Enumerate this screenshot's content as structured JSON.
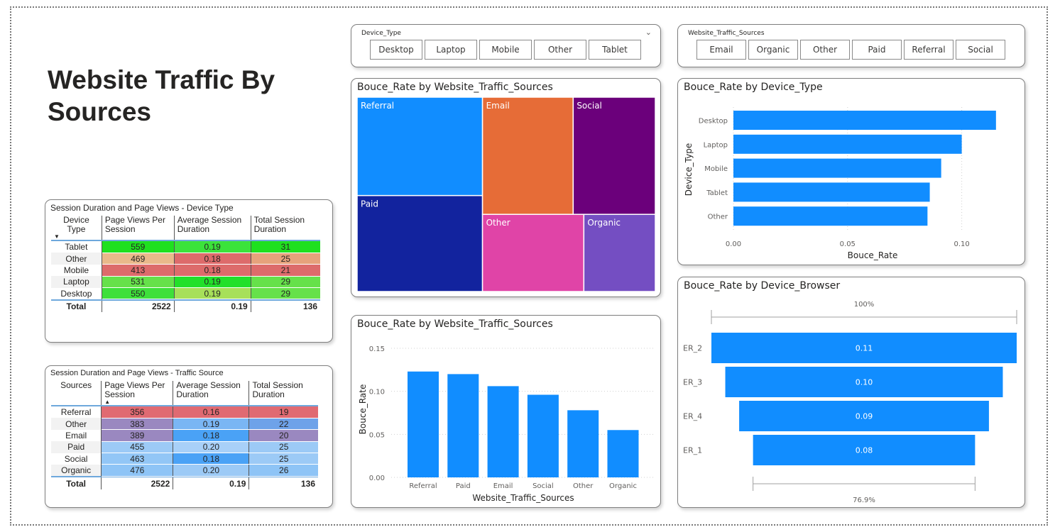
{
  "page": {
    "title": "Website Traffic By Sources"
  },
  "slicer_device": {
    "label": "Device_Type",
    "chevron_icon": "chevron-down-icon",
    "options": [
      "Desktop",
      "Laptop",
      "Mobile",
      "Other",
      "Tablet"
    ]
  },
  "slicer_source": {
    "label": "Website_Traffic_Sources",
    "options": [
      "Email",
      "Organic",
      "Other",
      "Paid",
      "Referral",
      "Social"
    ]
  },
  "table_device": {
    "title": "Session Duration and Page Views - Device Type",
    "headers": [
      "Device Type",
      "Page Views Per Session",
      "Average Session Duration",
      "Total Session Duration"
    ],
    "sort_icon": "sort-down-arrow-icon",
    "rows": [
      {
        "label": "Tablet",
        "values": [
          "559",
          "0.19",
          "31"
        ],
        "colors": [
          "#1fe01f",
          "#3be33b",
          "#1fe01f"
        ]
      },
      {
        "label": "Other",
        "values": [
          "469",
          "0.18",
          "25"
        ],
        "colors": [
          "#e9b98b",
          "#dd6b6b",
          "#e6a27c"
        ]
      },
      {
        "label": "Mobile",
        "values": [
          "413",
          "0.18",
          "21"
        ],
        "colors": [
          "#dd6b6b",
          "#dd6b6b",
          "#dd6b6b"
        ]
      },
      {
        "label": "Laptop",
        "values": [
          "531",
          "0.19",
          "29"
        ],
        "colors": [
          "#66e14a",
          "#22e02a",
          "#66e14a"
        ]
      },
      {
        "label": "Desktop",
        "values": [
          "550",
          "0.19",
          "29"
        ],
        "colors": [
          "#3ee03a",
          "#a7e05a",
          "#66e14a"
        ]
      }
    ],
    "total": {
      "label": "Total",
      "values": [
        "2522",
        "0.19",
        "136"
      ]
    }
  },
  "table_source": {
    "title": "Session Duration and Page Views - Traffic Source",
    "headers": [
      "Sources",
      "Page Views Per Session",
      "Average Session Duration",
      "Total Session Duration"
    ],
    "sort_icon": "sort-up-arrow-icon",
    "rows": [
      {
        "label": "Referral",
        "values": [
          "356",
          "0.16",
          "19"
        ],
        "colors": [
          "#e06a72",
          "#e06a72",
          "#e06a72"
        ]
      },
      {
        "label": "Other",
        "values": [
          "383",
          "0.19",
          "22"
        ],
        "colors": [
          "#9a88c0",
          "#7ab6f4",
          "#6ea2e9"
        ]
      },
      {
        "label": "Email",
        "values": [
          "389",
          "0.18",
          "20"
        ],
        "colors": [
          "#9a88c0",
          "#4aa2f6",
          "#9a88c0"
        ]
      },
      {
        "label": "Paid",
        "values": [
          "455",
          "0.20",
          "25"
        ],
        "colors": [
          "#9ccaf6",
          "#a8d0f8",
          "#9ccaf6"
        ]
      },
      {
        "label": "Social",
        "values": [
          "463",
          "0.18",
          "25"
        ],
        "colors": [
          "#92c6f6",
          "#4aa2f6",
          "#9ccaf6"
        ]
      },
      {
        "label": "Organic",
        "values": [
          "476",
          "0.20",
          "26"
        ],
        "colors": [
          "#8ec4f6",
          "#9ccaf6",
          "#8ec4f6"
        ]
      }
    ],
    "total": {
      "label": "Total",
      "values": [
        "2522",
        "0.19",
        "136"
      ]
    }
  },
  "chart_data": [
    {
      "type": "treemap",
      "title": "Bouce_Rate by Website_Traffic_Sources",
      "items": [
        {
          "name": "Referral",
          "value": 0.123,
          "color": "#118dff"
        },
        {
          "name": "Paid",
          "value": 0.12,
          "color": "#12239e"
        },
        {
          "name": "Email",
          "value": 0.106,
          "color": "#e66c37"
        },
        {
          "name": "Social",
          "value": 0.096,
          "color": "#6b007b"
        },
        {
          "name": "Other",
          "value": 0.078,
          "color": "#e044a7"
        },
        {
          "name": "Organic",
          "value": 0.055,
          "color": "#744ec2"
        }
      ]
    },
    {
      "type": "bar",
      "orientation": "horizontal",
      "title": "Bouce_Rate by Device_Type",
      "categories": [
        "Desktop",
        "Laptop",
        "Mobile",
        "Tablet",
        "Other"
      ],
      "values": [
        0.115,
        0.1,
        0.091,
        0.086,
        0.085
      ],
      "xlabel": "Bouce_Rate",
      "ylabel": "Device_Type",
      "xticks": [
        "0.00",
        "0.05",
        "0.10"
      ],
      "xlim": [
        0,
        0.125
      ],
      "color": "#118dff",
      "grid": true
    },
    {
      "type": "bar",
      "orientation": "vertical",
      "title": "Bouce_Rate by Website_Traffic_Sources",
      "categories": [
        "Referral",
        "Paid",
        "Email",
        "Social",
        "Other",
        "Organic"
      ],
      "values": [
        0.123,
        0.12,
        0.106,
        0.096,
        0.078,
        0.055
      ],
      "xlabel": "Website_Traffic_Sources",
      "ylabel": "Bouce_Rate",
      "yticks": [
        "0.00",
        "0.05",
        "0.10",
        "0.15"
      ],
      "ylim": [
        0,
        0.15
      ],
      "color": "#118dff",
      "grid": true
    },
    {
      "type": "funnel",
      "title": "Bouce_Rate by Device_Browser",
      "categories": [
        "ER_2",
        "ER_3",
        "ER_4",
        "ER_1"
      ],
      "values": [
        0.11,
        0.1,
        0.09,
        0.08
      ],
      "value_labels": [
        "0.11",
        "0.10",
        "0.09",
        "0.08"
      ],
      "top_label": "100%",
      "bottom_label": "76.9%",
      "color": "#118dff"
    }
  ]
}
